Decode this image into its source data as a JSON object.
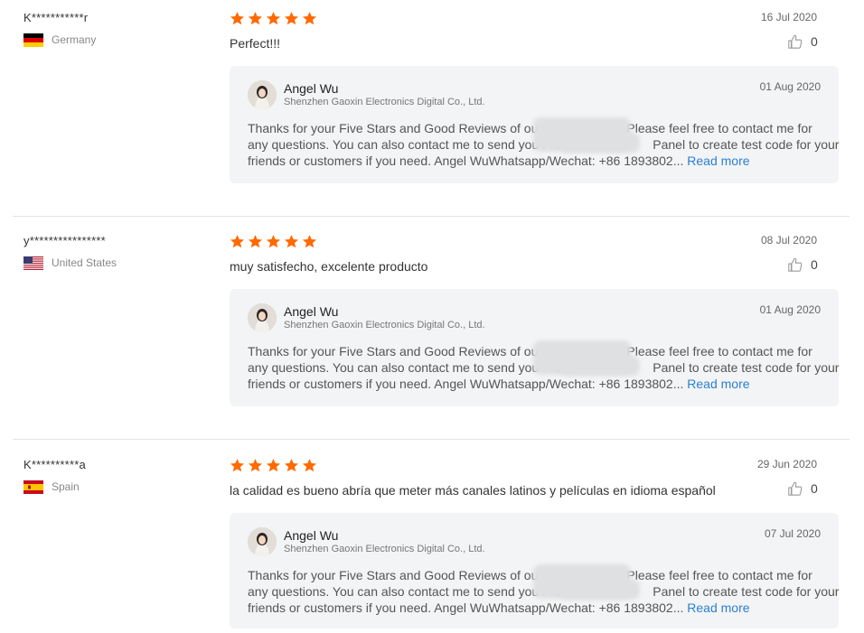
{
  "reviews": [
    {
      "reviewer": "K***********r",
      "country": "Germany",
      "date": "16 Jul 2020",
      "text": "Perfect!!!",
      "likes": "0",
      "rating": 5,
      "reply": {
        "seller": "Angel Wu",
        "company": "Shenzhen Gaoxin Electronics Digital Co., Ltd.",
        "date": "01 Aug 2020",
        "line1": "Thanks for your Five Stars and Good Reviews of our                        Please feel free to contact me for",
        "line2": "any questions. You can also contact me to send you Free                        Panel to create test code for your",
        "line3": "friends or customers if you need. Angel WuWhatsapp/Wechat: +86 1893802...",
        "read_more": "Read more"
      }
    },
    {
      "reviewer": "y****************",
      "country": "United States",
      "date": "08 Jul 2020",
      "text": "muy satisfecho, excelente producto",
      "likes": "0",
      "rating": 5,
      "reply": {
        "seller": "Angel Wu",
        "company": "Shenzhen Gaoxin Electronics Digital Co., Ltd.",
        "date": "01 Aug 2020",
        "line1": "Thanks for your Five Stars and Good Reviews of our                        Please feel free to contact me for",
        "line2": "any questions. You can also contact me to send you Free                        Panel to create test code for your",
        "line3": "friends or customers if you need. Angel WuWhatsapp/Wechat: +86 1893802...",
        "read_more": "Read more"
      }
    },
    {
      "reviewer": "K**********a",
      "country": "Spain",
      "date": "29 Jun 2020",
      "text": "la calidad es bueno abría que meter más canales latinos y películas en idioma español",
      "likes": "0",
      "rating": 5,
      "reply": {
        "seller": "Angel Wu",
        "company": "Shenzhen Gaoxin Electronics Digital Co., Ltd.",
        "date": "07 Jul 2020",
        "line1": "Thanks for your Five Stars and Good Reviews of our                        Please feel free to contact me for",
        "line2": "any questions. You can also contact me to send you Free                        Panel to create test code for your",
        "line3": "friends or customers if you need. Angel WuWhatsapp/Wechat: +86 1893802...",
        "read_more": "Read more"
      }
    }
  ],
  "colors": {
    "star": "#ff6a00",
    "link": "#2a7fd4",
    "reply_bg": "#f3f4f5"
  },
  "icons": {
    "star": "star-icon",
    "like": "thumbs-up-icon"
  }
}
